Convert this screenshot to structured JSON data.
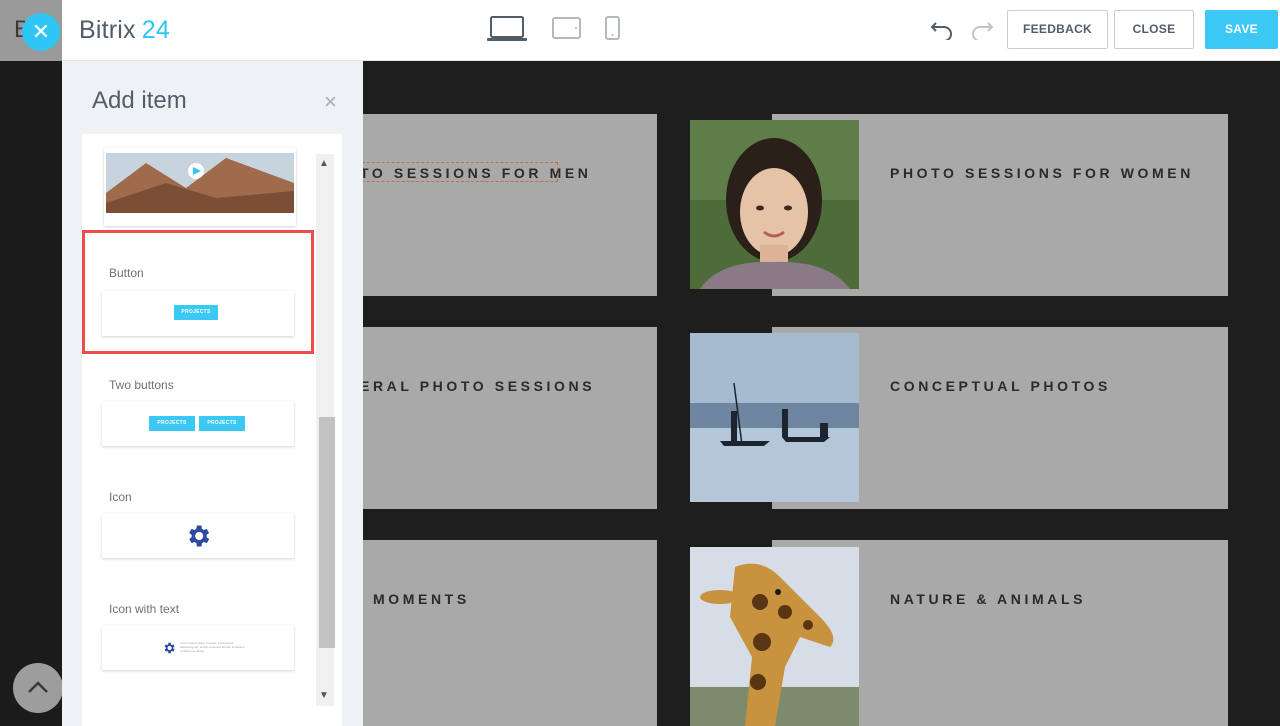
{
  "app": {
    "brand_name": "Bitrix",
    "brand_number": "24",
    "ghost_letter": "B"
  },
  "toolbar": {
    "feedback_label": "FEEDBACK",
    "close_label": "CLOSE",
    "save_label": "SAVE"
  },
  "panel": {
    "title": "Add item",
    "items": [
      {
        "label": "Button",
        "button_text": "PROJECTS"
      },
      {
        "label": "Two buttons",
        "button_text_1": "PROJECTS",
        "button_text_2": "PROJECTS"
      },
      {
        "label": "Icon"
      },
      {
        "label": "Icon with text",
        "preview_lines": [
          "Lorem ipsum dolor sit amet, consectetur",
          "adipiscing elit, sed do eiusmod tempor incididunt",
          "ut labore et dolore"
        ]
      }
    ]
  },
  "cards": [
    {
      "title": "TO SESSIONS FOR MEN"
    },
    {
      "title": "PHOTO SESSIONS FOR WOMEN"
    },
    {
      "title": "ERAL PHOTO SESSIONS"
    },
    {
      "title": "CONCEPTUAL PHOTOS"
    },
    {
      "title": "MOMENTS"
    },
    {
      "title": "NATURE & ANIMALS"
    }
  ],
  "colors": {
    "accent": "#2fc6f6",
    "highlight": "#f04b4b",
    "icon_blue": "#2d4aa0"
  }
}
